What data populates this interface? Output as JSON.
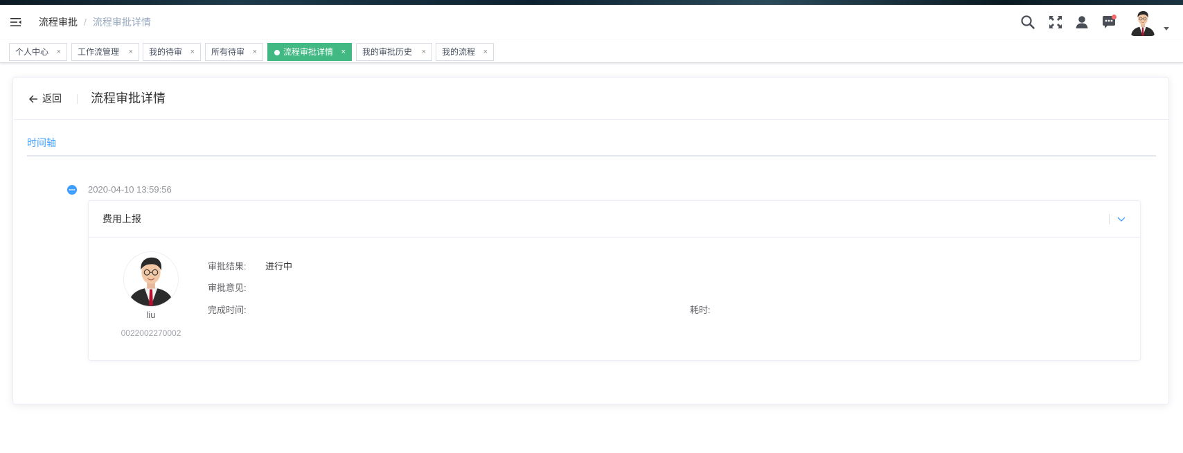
{
  "breadcrumb": {
    "parent": "流程审批",
    "current": "流程审批详情"
  },
  "nav_icons": [
    "menu-fold-icon",
    "search-icon",
    "fullscreen-icon",
    "user-icon",
    "message-icon"
  ],
  "tags": [
    {
      "label": "个人中心",
      "active": false
    },
    {
      "label": "工作流管理",
      "active": false
    },
    {
      "label": "我的待审",
      "active": false
    },
    {
      "label": "所有待审",
      "active": false
    },
    {
      "label": "流程审批详情",
      "active": true
    },
    {
      "label": "我的审批历史",
      "active": false
    },
    {
      "label": "我的流程",
      "active": false
    }
  ],
  "tag_close": "×",
  "page_header": {
    "back_label": "返回",
    "title": "流程审批详情"
  },
  "tabs": {
    "active": "时间轴"
  },
  "timeline": {
    "timestamp": "2020-04-10 13:59:56",
    "panel_title": "费用上报",
    "person": {
      "name": "liu",
      "id": "0022002270002"
    },
    "fields": {
      "result_label": "审批结果:",
      "result_value": "进行中",
      "opinion_label": "审批意见:",
      "opinion_value": "",
      "finish_label": "完成时间:",
      "finish_value": "",
      "duration_label": "耗时:",
      "duration_value": ""
    }
  },
  "colors": {
    "primary": "#409eff",
    "tag_active": "#42b983",
    "notify": "#f56c6c"
  }
}
